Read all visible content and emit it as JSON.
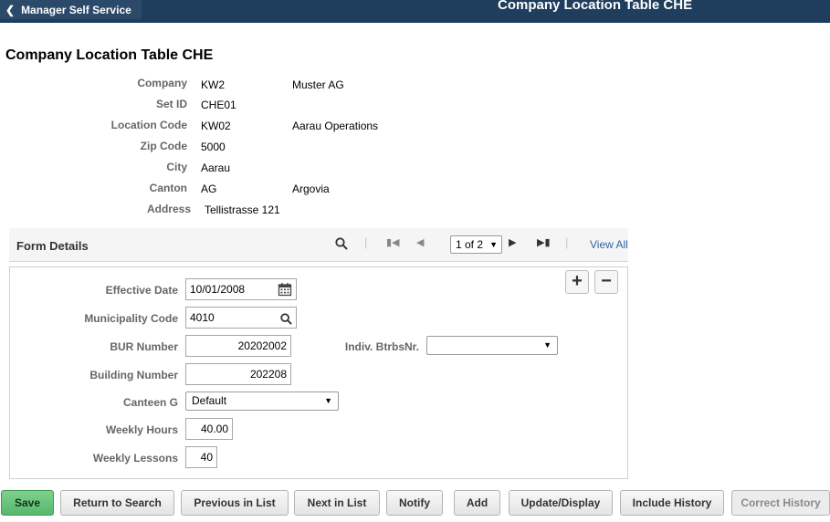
{
  "header": {
    "back_label": "Manager Self Service",
    "app_title": "Company Location Table CHE"
  },
  "page": {
    "title": "Company Location Table CHE"
  },
  "key_fields": {
    "company": {
      "label": "Company",
      "code": "KW2",
      "desc": "Muster AG"
    },
    "setid": {
      "label": "Set ID",
      "value": "CHE01"
    },
    "location": {
      "label": "Location Code",
      "code": "KW02",
      "desc": "Aarau Operations"
    },
    "zip": {
      "label": "Zip Code",
      "value": "5000"
    },
    "city": {
      "label": "City",
      "value": "Aarau"
    },
    "canton": {
      "label": "Canton",
      "code": "AG",
      "desc": "Argovia"
    },
    "address": {
      "label": "Address",
      "value": "Tellistrasse 121"
    }
  },
  "form_details": {
    "title": "Form Details",
    "pager": "1 of 2",
    "view_all": "View All",
    "effective_date": {
      "label": "Effective Date",
      "value": "10/01/2008"
    },
    "municipality": {
      "label": "Municipality Code",
      "value": "4010"
    },
    "bur_number": {
      "label": "BUR Number",
      "value": "20202002"
    },
    "indiv": {
      "label": "Indiv. BtrbsNr.",
      "value": ""
    },
    "building_number": {
      "label": "Building Number",
      "value": "202208"
    },
    "canteen": {
      "label": "Canteen G",
      "value": "Default"
    },
    "weekly_hours": {
      "label": "Weekly Hours",
      "value": "40.00"
    },
    "weekly_lessons": {
      "label": "Weekly Lessons",
      "value": "40"
    }
  },
  "toolbar": {
    "save": "Save",
    "return_to_search": "Return to Search",
    "previous_in_list": "Previous in List",
    "next_in_list": "Next in List",
    "notify": "Notify",
    "add": "Add",
    "update_display": "Update/Display",
    "include_history": "Include History",
    "correct_history": "Correct History"
  },
  "icons": {
    "back": "chevron-left-icon",
    "search": "magnifier-icon",
    "first": "first-page-icon",
    "prev": "previous-page-icon",
    "next": "next-page-icon",
    "last": "last-page-icon",
    "calendar": "calendar-icon",
    "add_row": "plus-icon",
    "delete_row": "minus-icon"
  },
  "colors": {
    "header_bg": "#1f3d5c",
    "save_button": "#57b86b",
    "link": "#2e64a8"
  }
}
